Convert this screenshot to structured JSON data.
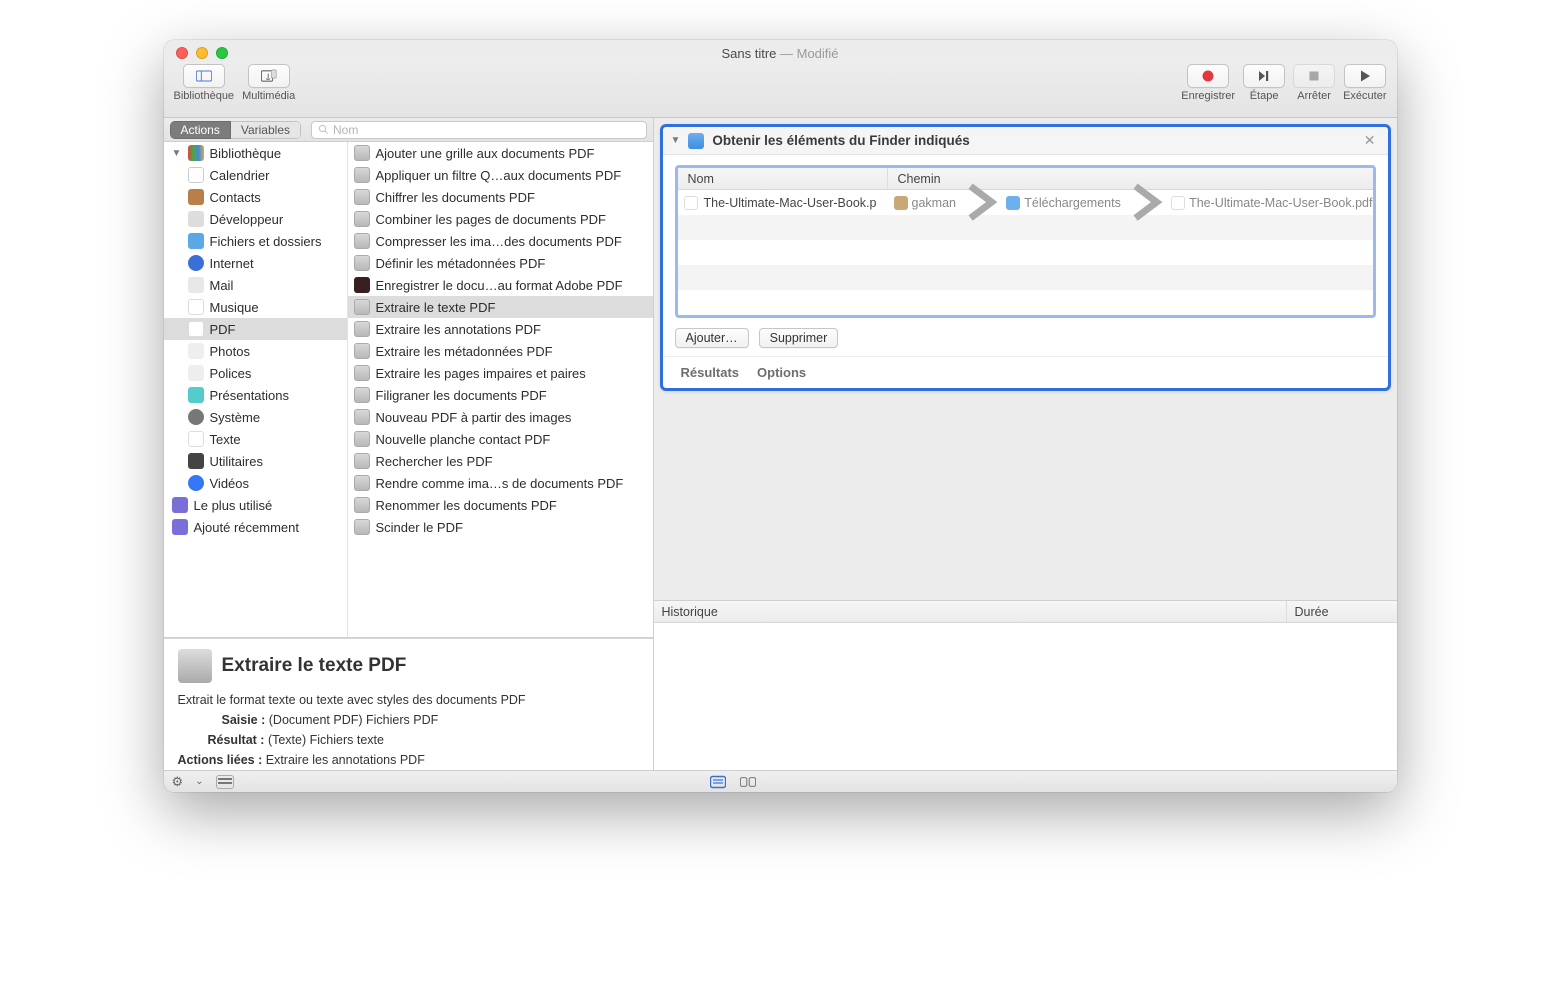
{
  "window": {
    "title": "Sans titre",
    "modified_suffix": " — Modifié"
  },
  "toolbar": {
    "library_label": "Bibliothèque",
    "media_label": "Multimédia",
    "record_label": "Enregistrer",
    "step_label": "Étape",
    "stop_label": "Arrêter",
    "run_label": "Exécuter"
  },
  "library": {
    "tabs": {
      "actions": "Actions",
      "variables": "Variables"
    },
    "search_placeholder": "Nom",
    "root_label": "Bibliothèque",
    "categories": [
      {
        "label": "Calendrier",
        "icon": "ic-cal"
      },
      {
        "label": "Contacts",
        "icon": "ic-contacts"
      },
      {
        "label": "Développeur",
        "icon": "ic-dev"
      },
      {
        "label": "Fichiers et dossiers",
        "icon": "ic-folder"
      },
      {
        "label": "Internet",
        "icon": "ic-internet"
      },
      {
        "label": "Mail",
        "icon": "ic-mail"
      },
      {
        "label": "Musique",
        "icon": "ic-music"
      },
      {
        "label": "PDF",
        "icon": "ic-pdf",
        "selected": true
      },
      {
        "label": "Photos",
        "icon": "ic-photos"
      },
      {
        "label": "Polices",
        "icon": "ic-fonts"
      },
      {
        "label": "Présentations",
        "icon": "ic-pres"
      },
      {
        "label": "Système",
        "icon": "ic-sys"
      },
      {
        "label": "Texte",
        "icon": "ic-text"
      },
      {
        "label": "Utilitaires",
        "icon": "ic-util"
      },
      {
        "label": "Vidéos",
        "icon": "ic-video"
      }
    ],
    "smart_folders": [
      {
        "label": "Le plus utilisé",
        "icon": "ic-purple"
      },
      {
        "label": "Ajouté récemment",
        "icon": "ic-purple"
      }
    ],
    "actions": [
      {
        "label": "Ajouter une grille aux documents PDF"
      },
      {
        "label": "Appliquer un filtre Q…aux documents PDF"
      },
      {
        "label": "Chiffrer les documents PDF"
      },
      {
        "label": "Combiner les pages de documents PDF"
      },
      {
        "label": "Compresser les ima…des documents PDF"
      },
      {
        "label": "Définir les métadonnées PDF"
      },
      {
        "label": "Enregistrer le docu…au format Adobe PDF",
        "adobe": true
      },
      {
        "label": "Extraire le texte PDF",
        "selected": true
      },
      {
        "label": "Extraire les annotations PDF"
      },
      {
        "label": "Extraire les métadonnées PDF"
      },
      {
        "label": "Extraire les pages impaires et paires"
      },
      {
        "label": "Filigraner les documents PDF"
      },
      {
        "label": "Nouveau PDF à partir des images"
      },
      {
        "label": "Nouvelle planche contact PDF"
      },
      {
        "label": "Rechercher les PDF"
      },
      {
        "label": "Rendre comme ima…s de documents PDF"
      },
      {
        "label": "Renommer les documents PDF"
      },
      {
        "label": "Scinder le PDF"
      }
    ]
  },
  "description": {
    "title": "Extraire le texte PDF",
    "body": "Extrait le format texte ou texte avec styles des documents PDF",
    "input_label": "Saisie :",
    "input_value": "(Document PDF) Fichiers PDF",
    "output_label": "Résultat :",
    "output_value": "(Texte) Fichiers texte",
    "related_label": "Actions liées :",
    "related_value": "Extraire les annotations PDF"
  },
  "workflow": {
    "action_title": "Obtenir les éléments du Finder indiqués",
    "table": {
      "col_nom": "Nom",
      "col_chemin": "Chemin",
      "rows": [
        {
          "name": "The-Ultimate-Mac-User-Book.p",
          "path_segments": [
            "gakman",
            "Téléchargements",
            "The-Ultimate-Mac-User-Book.pdf"
          ]
        }
      ]
    },
    "add_button": "Ajouter…",
    "remove_button": "Supprimer",
    "footer": {
      "results": "Résultats",
      "options": "Options"
    }
  },
  "log": {
    "history_label": "Historique",
    "duration_label": "Durée"
  }
}
